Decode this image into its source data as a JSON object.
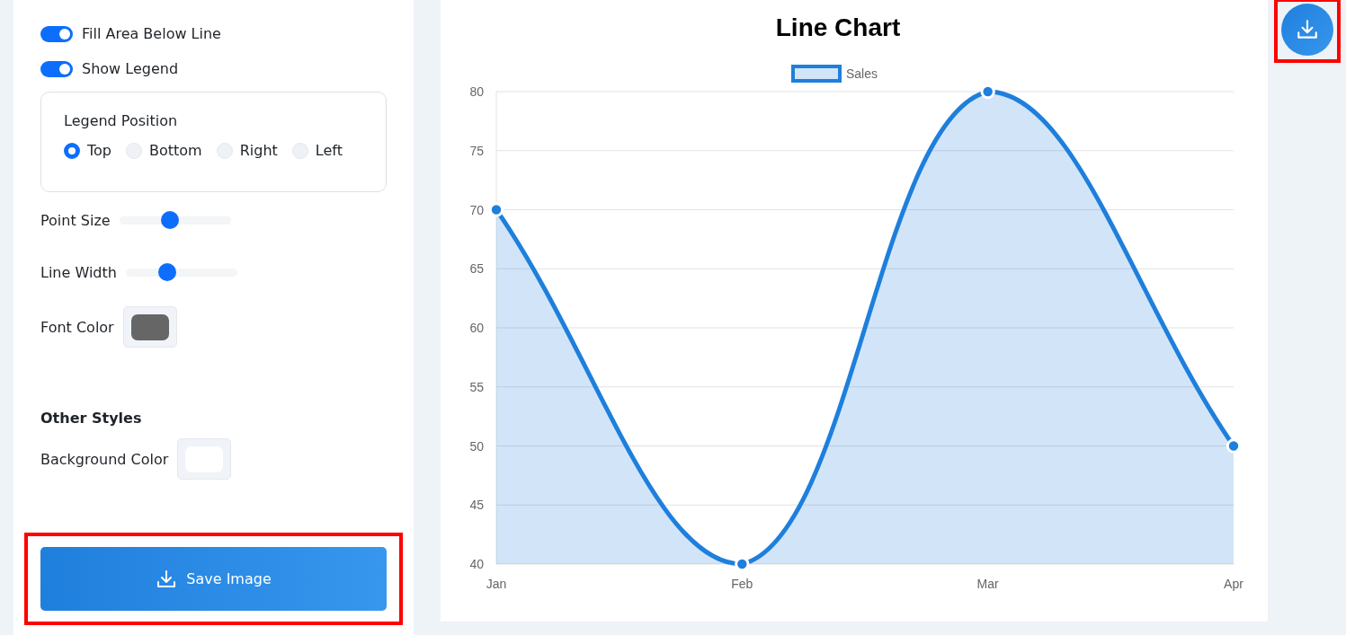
{
  "controls": {
    "toggles": [
      {
        "label": "Fill Area Below Line",
        "on": true
      },
      {
        "label": "Show Legend",
        "on": true
      }
    ],
    "legend_position": {
      "title": "Legend Position",
      "options": [
        {
          "label": "Top",
          "selected": true
        },
        {
          "label": "Bottom",
          "selected": false
        },
        {
          "label": "Right",
          "selected": false
        },
        {
          "label": "Left",
          "selected": false
        }
      ]
    },
    "sliders": [
      {
        "label": "Point Size",
        "level": 0.47
      },
      {
        "label": "Line Width",
        "level": 0.39
      }
    ],
    "font_color": {
      "label": "Font Color",
      "color": "#666666"
    },
    "other_styles": {
      "title": "Other Styles",
      "background_color": {
        "label": "Background Color",
        "color": "#ffffff"
      }
    },
    "save_button": {
      "label": "Save Image",
      "highlighted": true
    }
  },
  "chart": {
    "chart_data": {
      "type": "line",
      "title": "Line Chart",
      "categories": [
        "Jan",
        "Feb",
        "Mar",
        "Apr"
      ],
      "series": [
        {
          "name": "Sales",
          "color": "#1e7fdc",
          "marker": true,
          "values": [
            70,
            40,
            80,
            50
          ]
        }
      ],
      "grid": true,
      "ylim": [
        40,
        80
      ],
      "yticks": [
        40,
        45,
        50,
        55,
        60,
        65,
        70,
        75,
        80
      ]
    }
  },
  "download_button": {
    "highlighted": true
  }
}
